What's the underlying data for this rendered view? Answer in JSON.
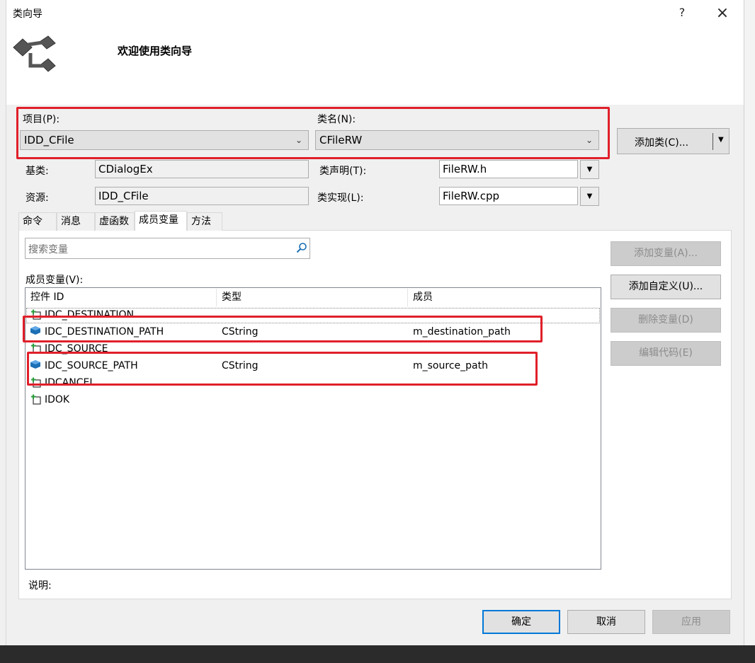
{
  "window": {
    "title": "类向导",
    "help_glyph": "?",
    "close_glyph": "×",
    "welcome": "欢迎使用类向导"
  },
  "top": {
    "project_label": "项目(P):",
    "project_value": "IDD_CFile",
    "class_label": "类名(N):",
    "class_value": "CFileRW",
    "add_class_button": "添加类(C)...",
    "base_label": "基类:",
    "base_value": "CDialogEx",
    "resource_label": "资源:",
    "resource_value": "IDD_CFile",
    "decl_label": "类声明(T):",
    "decl_value": "FileRW.h",
    "impl_label": "类实现(L):",
    "impl_value": "FileRW.cpp"
  },
  "tabs": [
    {
      "label": "命令"
    },
    {
      "label": "消息"
    },
    {
      "label": "虚函数"
    },
    {
      "label": "成员变量"
    },
    {
      "label": "方法"
    }
  ],
  "panel": {
    "search_placeholder": "搜索变量",
    "list_label": "成员变量(V):",
    "columns": [
      "控件 ID",
      "类型",
      "成员"
    ],
    "rows": [
      {
        "id": "IDC_DESTINATION",
        "type": "",
        "member": "",
        "icon": "control-icon"
      },
      {
        "id": "IDC_DESTINATION_PATH",
        "type": "CString",
        "member": "m_destination_path",
        "icon": "variable-icon"
      },
      {
        "id": "IDC_SOURCE",
        "type": "",
        "member": "",
        "icon": "control-icon"
      },
      {
        "id": "IDC_SOURCE_PATH",
        "type": "CString",
        "member": "m_source_path",
        "icon": "variable-icon"
      },
      {
        "id": "IDCANCEL",
        "type": "",
        "member": "",
        "icon": "control-icon"
      },
      {
        "id": "IDOK",
        "type": "",
        "member": "",
        "icon": "control-icon"
      }
    ],
    "desc_label": "说明:",
    "buttons": {
      "add_variable": "添加变量(A)...",
      "add_custom": "添加自定义(U)...",
      "delete_variable": "删除变量(D)",
      "edit_code": "编辑代码(E)"
    }
  },
  "footer": {
    "ok": "确定",
    "cancel": "取消",
    "apply": "应用"
  },
  "colors": {
    "highlight_box": "#e0202a",
    "default_button_border": "#0078d7",
    "variable_icon": "#1b6fb5",
    "control_icon_plus": "#2a9d3a"
  }
}
